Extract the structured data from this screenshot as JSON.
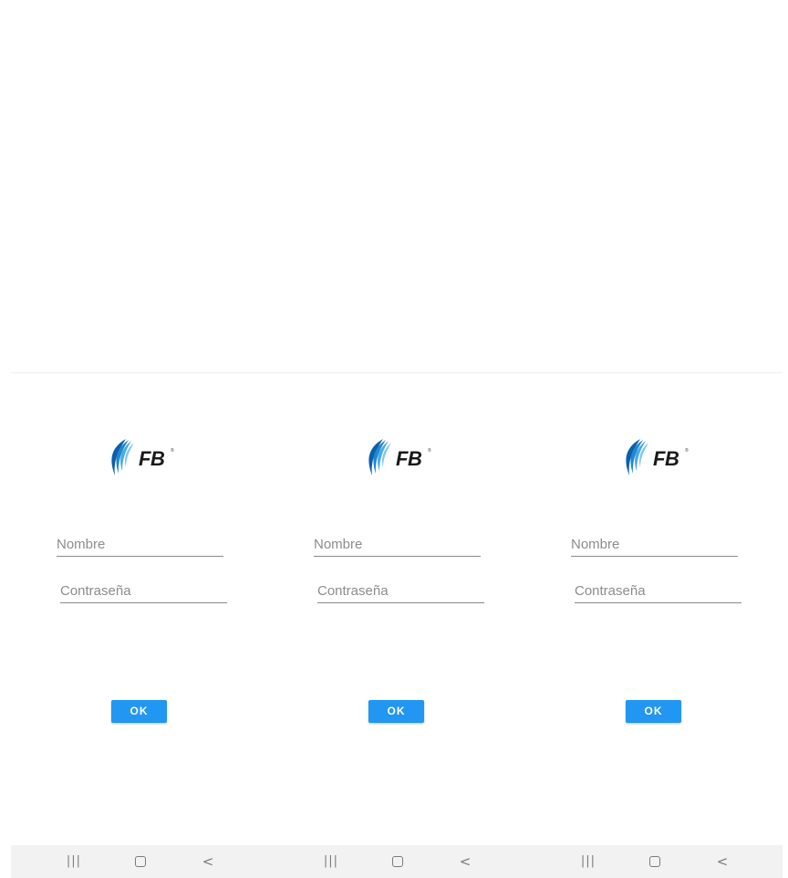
{
  "app": {
    "logo_text": "FB",
    "logo_mark": "®"
  },
  "panels": [
    {
      "name_placeholder": "Nombre",
      "password_placeholder": "Contraseña",
      "ok_label": "OK"
    },
    {
      "name_placeholder": "Nombre",
      "password_placeholder": "Contraseña",
      "ok_label": "OK"
    },
    {
      "name_placeholder": "Nombre",
      "password_placeholder": "Contraseña",
      "ok_label": "OK"
    }
  ],
  "navbar": {
    "recents_icon": "recents-icon",
    "home_icon": "home-icon",
    "back_icon": "back-icon",
    "recents_glyph": "|||",
    "back_glyph": "<"
  },
  "colors": {
    "accent": "#2196f3",
    "logo_blue_dark": "#0d5fa8",
    "logo_blue_light": "#7cc8ef",
    "navbar_bg": "#f2f2f2"
  }
}
